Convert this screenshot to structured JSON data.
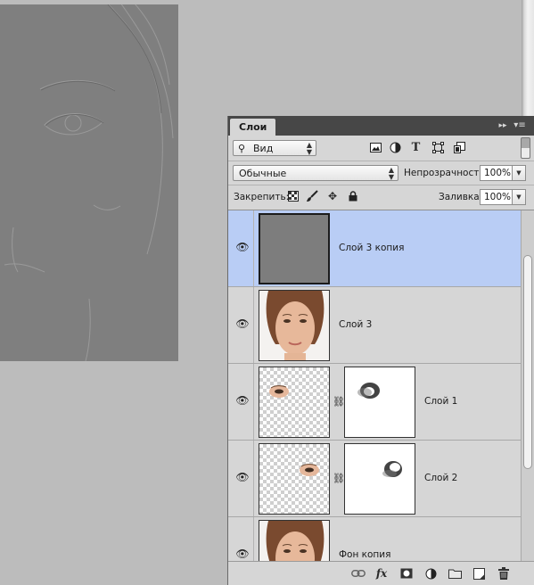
{
  "panel": {
    "tab_label": "Слои",
    "collapse_glyph": "▸▸",
    "menu_glyph": "▾≡"
  },
  "filter": {
    "kind_label": "Вид",
    "icons": [
      "image-filter-icon",
      "adjustment-filter-icon",
      "type-filter-icon",
      "shape-filter-icon",
      "smart-object-filter-icon"
    ]
  },
  "blend": {
    "mode": "Обычные",
    "opacity_label": "Непрозрачность:",
    "opacity_value": "100%"
  },
  "lock": {
    "label": "Закрепить:",
    "icons": [
      "lock-transparent-pixels-icon",
      "lock-image-pixels-icon",
      "lock-position-icon",
      "lock-all-icon"
    ],
    "fill_label": "Заливка:",
    "fill_value": "100%"
  },
  "layers": [
    {
      "name": "Слой 3 копия",
      "visible": true,
      "selected": true,
      "thumbnail": "gray-fill"
    },
    {
      "name": "Слой 3",
      "visible": true,
      "selected": false,
      "thumbnail": "face-portrait"
    },
    {
      "name": "Слой 1",
      "visible": true,
      "selected": false,
      "thumbnail": "eye-left-transparent",
      "has_mask": true
    },
    {
      "name": "Слой 2",
      "visible": true,
      "selected": false,
      "thumbnail": "eye-right-transparent",
      "has_mask": true
    },
    {
      "name": "Фон копия",
      "visible": true,
      "selected": false,
      "thumbnail": "face-portrait"
    }
  ],
  "bottom_toolbar": {
    "fx_label": "fx",
    "icons": [
      "link-layers-icon",
      "layer-style-icon",
      "add-mask-icon",
      "new-adjustment-icon",
      "new-group-icon",
      "new-layer-icon",
      "delete-layer-icon"
    ]
  },
  "colors": {
    "selected_row": "#b9cdf5",
    "panel_bg": "#d6d6d6",
    "canvas_bg": "#bcbcbc",
    "document_gray": "#7f7f7f"
  }
}
